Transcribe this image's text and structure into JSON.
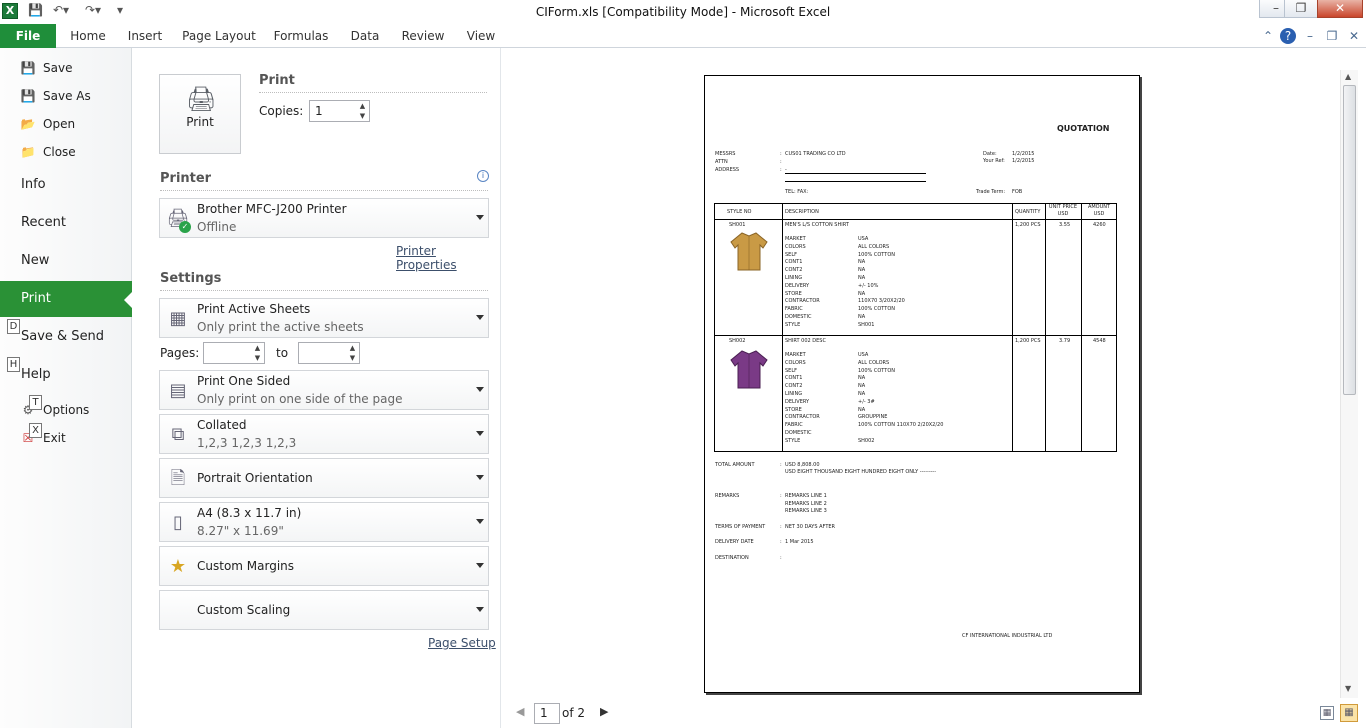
{
  "window": {
    "title": "CIForm.xls  [Compatibility Mode]  -  Microsoft Excel",
    "logo": "X"
  },
  "ribbon": {
    "tabs": [
      "File",
      "Home",
      "Insert",
      "Page Layout",
      "Formulas",
      "Data",
      "Review",
      "View"
    ],
    "accent": "#1f8e3a"
  },
  "backstage": {
    "items": [
      "Save",
      "Save As",
      "Open",
      "Close",
      "Info",
      "Recent",
      "New",
      "Print",
      "Save & Send",
      "Help",
      "Options",
      "Exit"
    ],
    "keytips": [
      "D",
      "H",
      "T",
      "X"
    ]
  },
  "print": {
    "heading": "Print",
    "button": "Print",
    "copies_label": "Copies:",
    "copies_value": "1"
  },
  "printer": {
    "heading": "Printer",
    "name": "Brother MFC-J200 Printer",
    "status": "Offline",
    "properties_link": "Printer Properties"
  },
  "settings": {
    "heading": "Settings",
    "what": {
      "main": "Print Active Sheets",
      "sub": "Only print the active sheets"
    },
    "pages_label": "Pages:",
    "pages_to": "to",
    "sides": {
      "main": "Print One Sided",
      "sub": "Only print on one side of the page"
    },
    "collate": {
      "main": "Collated",
      "sub": "1,2,3    1,2,3    1,2,3"
    },
    "orientation": "Portrait Orientation",
    "paper": {
      "main": "A4 (8.3 x 11.7 in)",
      "sub": "8.27\" x 11.69\""
    },
    "margins": "Custom Margins",
    "scaling": "Custom Scaling",
    "page_setup_link": "Page Setup"
  },
  "preview": {
    "current_page": "1",
    "of_pages": "of 2",
    "doc": {
      "title": "QUOTATION",
      "messrs_label": "MESSRS",
      "messrs_value": "CUS01 TRADING CO LTD",
      "attn_label": "ATTN",
      "address_label": "ADDRESS",
      "address_value": "-",
      "date_label": "Date:",
      "date_value": "1/2/2015",
      "yourref_label": "Your Ref:",
      "yourref_value": "1/2/2015",
      "tel_fax": "TEL:   FAX:",
      "trade_label": "Trade Term:",
      "trade_value": "FOB",
      "headers": [
        "STYLE NO",
        "DESCRIPTION",
        "QUANTITY",
        "UNIT PRICE USD",
        "AMOUNT USD"
      ],
      "spec_labels": [
        "MARKET",
        "COLORS",
        "SELF",
        "CONT1",
        "CONT2",
        "LINING",
        "DELIVERY",
        "STORE",
        "CONTRACTOR",
        "FABRIC",
        "DOMESTIC",
        "STYLE"
      ],
      "items": [
        {
          "style": "SH001",
          "desc": "MEN'S L/S COTTON SHIRT",
          "qty": "1,200 PCS",
          "price": "3.55",
          "amount": "4260",
          "specs": [
            "USA",
            "ALL COLORS",
            "100% COTTON",
            "NA",
            "NA",
            "NA",
            "+/- 10%",
            "NA",
            "110X70 3/20X2/20",
            "100% COTTON",
            "NA",
            "SH001"
          ]
        },
        {
          "style": "SH002",
          "desc": "SHIRT 002 DESC",
          "qty": "1,200 PCS",
          "price": "3.79",
          "amount": "4548",
          "specs": [
            "USA",
            "ALL COLORS",
            "100% COTTON",
            "NA",
            "NA",
            "NA",
            "+/- 3#",
            "NA",
            "GROUPPINE",
            "100% COTTON 110X70 2/20X2/20",
            "",
            "SH002"
          ]
        }
      ],
      "total_label": "TOTAL AMOUNT",
      "total_value": "USD 8,808.00",
      "total_words": "USD EIGHT THOUSAND EIGHT HUNDRED EIGHT ONLY ---------",
      "remarks_label": "REMARKS",
      "remarks": [
        "REMARKS LINE 1",
        "REMARKS LINE 2",
        "REMARKS LINE 3"
      ],
      "terms_label": "TERMS OF PAYMENT",
      "terms_value": "NET 30 DAYS AFTER",
      "delivery_label": "DELIVERY DATE",
      "delivery_value": "1 Mar 2015",
      "destination_label": "DESTINATION",
      "company": "CF INTERNATIONAL INDUSTRIAL LTD"
    }
  },
  "colors": {
    "shirt1": "#c99a45",
    "shirt2": "#7a3a86"
  }
}
